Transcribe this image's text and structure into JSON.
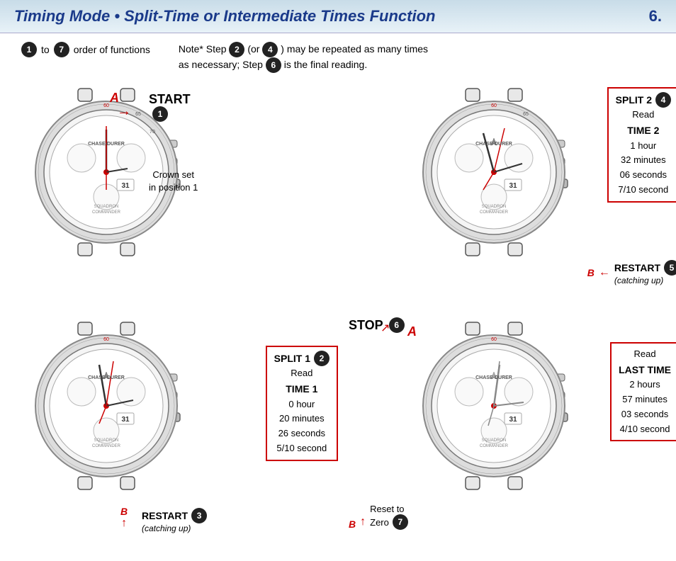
{
  "header": {
    "title": "Timing Mode • Split-Time or Intermediate Times Function",
    "page_num": "6."
  },
  "top_note": {
    "order_text": "to",
    "order_start": "1",
    "order_end": "7",
    "order_suffix": "order of functions",
    "note": "Note* Step",
    "note_step1": "2",
    "note_mid": "(or",
    "note_step2": "4",
    "note_mid2": ") may be repeated as many times",
    "note_line2": "as necessary; Step",
    "note_step3": "6",
    "note_end": "is the final reading."
  },
  "quadrants": {
    "q1": {
      "label_letter": "A",
      "action": "START",
      "step": "1",
      "crown_text": "Crown set\nin position 1"
    },
    "q2": {
      "box_title": "SPLIT 2",
      "step": "4",
      "read": "Read",
      "time_label": "TIME 2",
      "detail1": "1 hour",
      "detail2": "32 minutes",
      "detail3": "06 seconds",
      "detail4": "7/10 second",
      "restart_letter": "B",
      "restart_action": "RESTART",
      "restart_step": "5",
      "restart_sub": "(catching up)"
    },
    "q3": {
      "box_title": "SPLIT 1",
      "step": "2",
      "read": "Read",
      "time_label": "TIME 1",
      "detail1": "0 hour",
      "detail2": "20 minutes",
      "detail3": "26 seconds",
      "detail4": "5/10 second",
      "restart_letter": "B",
      "restart_action": "RESTART",
      "restart_step": "3",
      "restart_sub": "(catching up)"
    },
    "q4": {
      "label_letter": "A",
      "action": "STOP",
      "step": "6",
      "box_title": "Read",
      "time_label": "LAST TIME",
      "detail1": "2 hours",
      "detail2": "57 minutes",
      "detail3": "03 seconds",
      "detail4": "4/10 second",
      "reset_letter": "B",
      "reset_text": "Reset to",
      "reset_line2": "Zero",
      "reset_step": "7"
    }
  }
}
